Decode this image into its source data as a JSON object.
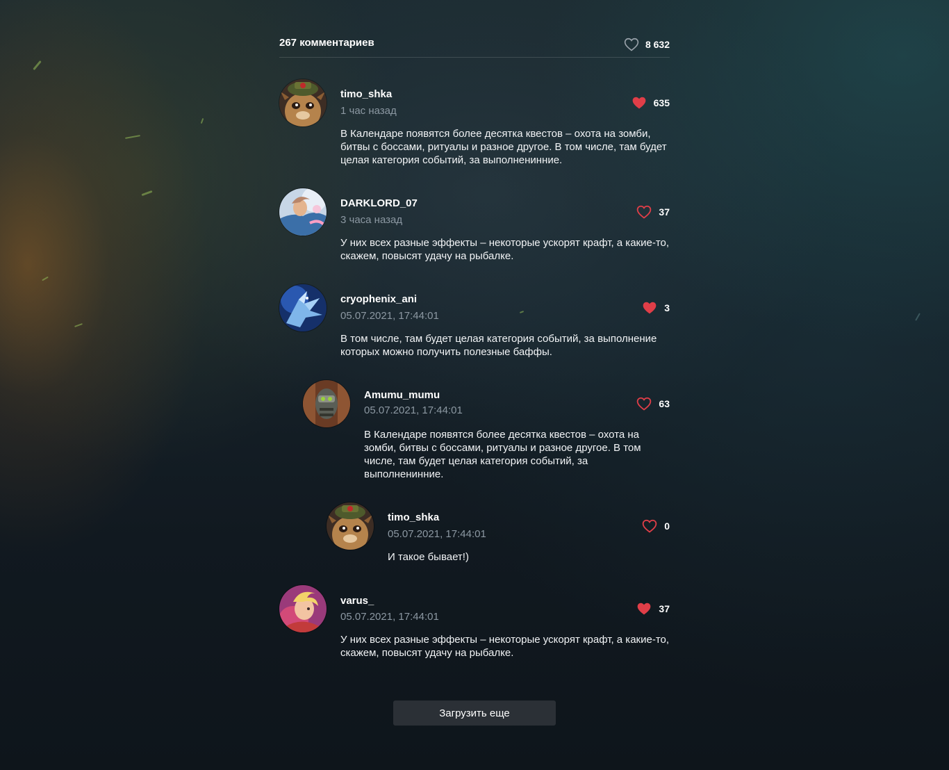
{
  "comments_header": {
    "count_label": "267 комментариев",
    "likes_total": "8 632"
  },
  "comments": [
    {
      "avatar": "teemo-avatar",
      "username": "timo_shka",
      "time": "1 час назад",
      "text": "В Календаре появятся более десятка квестов – охота на зомби, битвы с боссами, ритуалы и разное другое. В том числе, там будет целая категория событий, за выполненинние.",
      "likes": "635",
      "liked": true
    },
    {
      "avatar": "ezreal-avatar",
      "username": "DARKLORD_07",
      "time": "3 часа назад",
      "text": "У них всех разные эффекты – некоторые ускорят крафт, а какие-то, скажем, повысят удачу на рыбалке.",
      "likes": "37",
      "liked": false
    },
    {
      "avatar": "anivia-avatar",
      "username": "cryophenix_ani",
      "time": "05.07.2021, 17:44:01",
      "text": "В том числе, там будет целая категория событий, за выполнение которых можно получить полезные баффы.",
      "likes": "3",
      "liked": true
    },
    {
      "avatar": "amumu-avatar",
      "username": "Amumu_mumu",
      "time": "05.07.2021, 17:44:01",
      "text": "В Календаре появятся более десятка квестов – охота на зомби, битвы с боссами, ритуалы и разное другое. В том числе, там будет целая категория событий, за выполненинние.",
      "likes": "63",
      "liked": false
    },
    {
      "avatar": "teemo-avatar",
      "username": "timo_shka",
      "time": "05.07.2021, 17:44:01",
      "text": "И такое бывает!)",
      "likes": "0",
      "liked": false
    },
    {
      "avatar": "varus-avatar",
      "username": "varus_",
      "time": "05.07.2021, 17:44:01",
      "text": "У них всех разные эффекты – некоторые ускорят крафт, а какие-то, скажем, повысят удачу на рыбалке.",
      "likes": "37",
      "liked": true
    }
  ],
  "load_more_label": "Загрузить еще",
  "colors": {
    "like_active": "#e03e48",
    "like_outline_header": "#9aa3ab",
    "secondary_text": "#8c98a2",
    "button_bg": "#2b3036"
  }
}
